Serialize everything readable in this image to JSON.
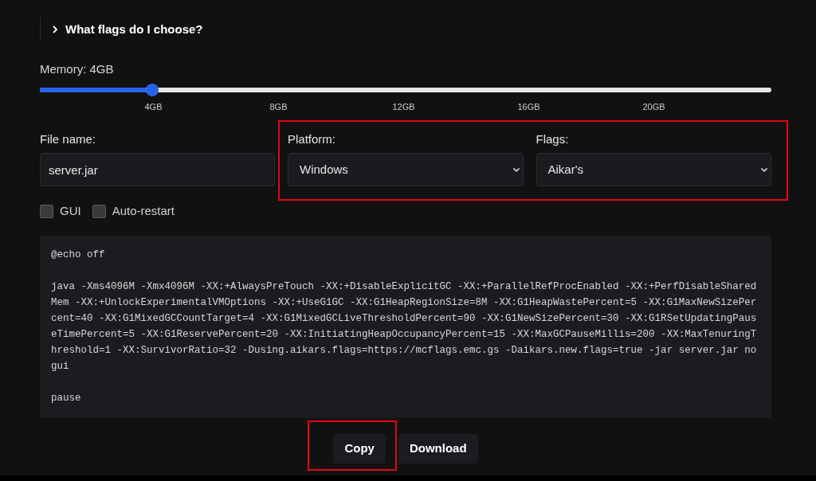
{
  "disclosure": {
    "label": "What flags do I choose?",
    "expanded": false
  },
  "memory": {
    "label": "Memory: 4GB",
    "level": 0.154,
    "ticks": [
      "4GB",
      "8GB",
      "12GB",
      "16GB",
      "20GB"
    ]
  },
  "file_name": {
    "label": "File name:",
    "value": "server.jar"
  },
  "dropdowns": {
    "highlighted": true,
    "items": [
      {
        "label": "Platform:",
        "value": "Windows"
      },
      {
        "label": "Flags:",
        "value": "Aikar's"
      }
    ]
  },
  "options": [
    {
      "label": "GUI",
      "checked": false
    },
    {
      "label": "Auto-restart",
      "checked": false
    }
  ],
  "script": {
    "code": "@echo off\n\njava -Xms4096M -Xmx4096M -XX:+AlwaysPreTouch -XX:+DisableExplicitGC -XX:+ParallelRefProcEnabled -XX:+PerfDisableSharedMem -XX:+UnlockExperimentalVMOptions -XX:+UseG1GC -XX:G1HeapRegionSize=8M -XX:G1HeapWastePercent=5 -XX:G1MaxNewSizePercent=40 -XX:G1MixedGCCountTarget=4 -XX:G1MixedGCLiveThresholdPercent=90 -XX:G1NewSizePercent=30 -XX:G1RSetUpdatingPauseTimePercent=5 -XX:G1ReservePercent=20 -XX:InitiatingHeapOccupancyPercent=15 -XX:MaxGCPauseMillis=200 -XX:MaxTenuringThreshold=1 -XX:SurvivorRatio=32 -Dusing.aikars.flags=https://mcflags.emc.gs -Daikars.new.flags=true -jar server.jar nogui\n\npause"
  },
  "buttons": [
    {
      "label": "Copy",
      "highlighted": true
    },
    {
      "label": "Download",
      "highlighted": false
    }
  ]
}
